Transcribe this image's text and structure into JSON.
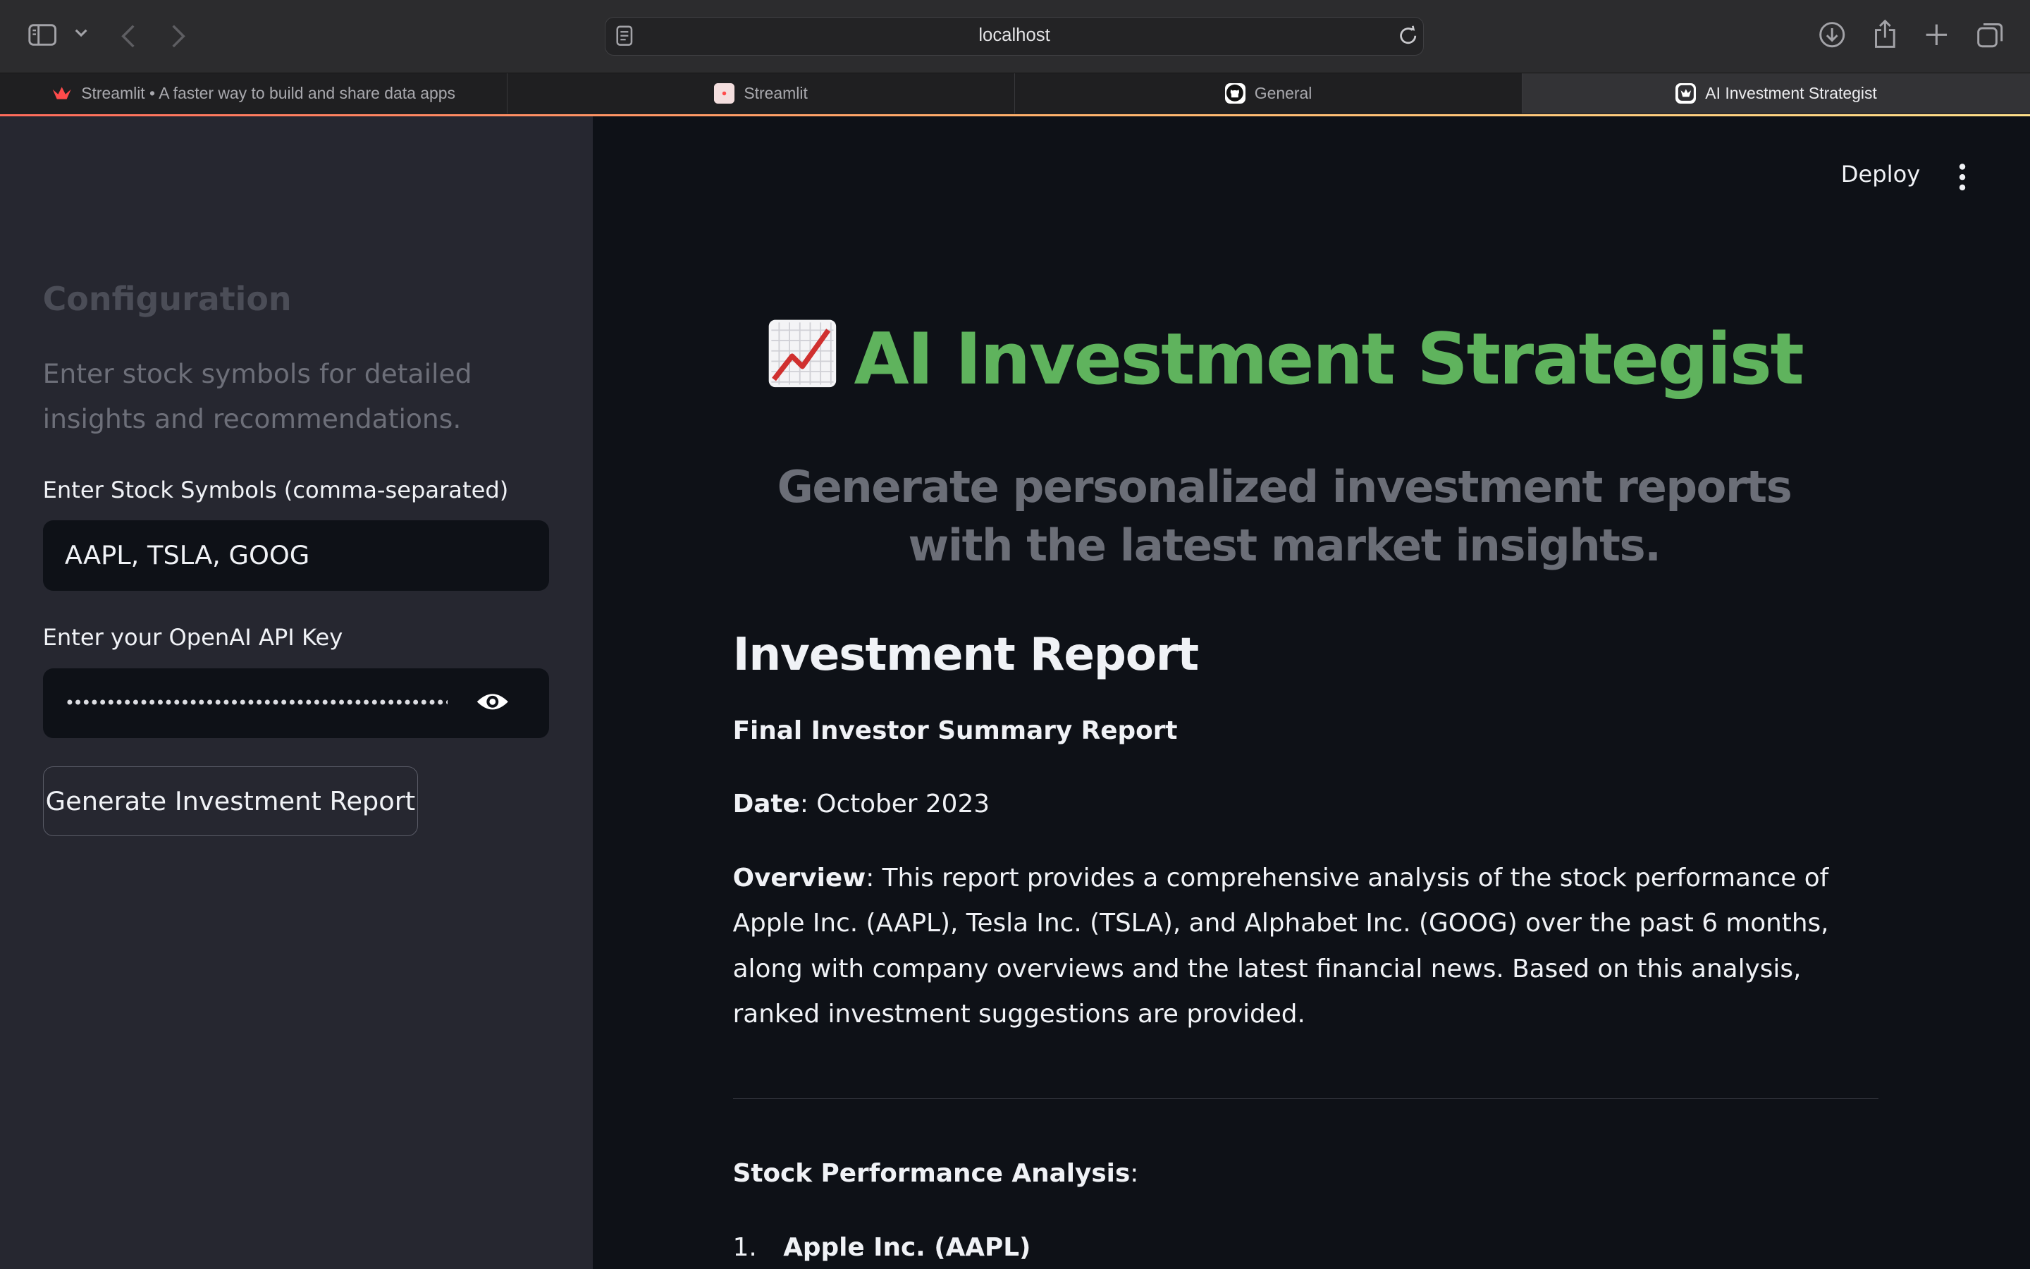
{
  "browser": {
    "url": "localhost",
    "tabs": [
      {
        "title": "Streamlit • A faster way to build and share data apps",
        "icon": "streamlit-crown-icon"
      },
      {
        "title": "Streamlit",
        "icon": "streamlit-favicon"
      },
      {
        "title": "General",
        "icon": "github-icon"
      },
      {
        "title": "AI Investment Strategist",
        "icon": "streamlit-favicon"
      }
    ],
    "active_tab": 3
  },
  "sidebar": {
    "title": "Configuration",
    "description": "Enter stock symbols for detailed insights and recommendations.",
    "symbols_label": "Enter Stock Symbols (comma-separated)",
    "symbols_value": "AAPL, TSLA, GOOG",
    "api_key_label": "Enter your OpenAI API Key",
    "api_key_value": "••••••••••••••••••••••••••••••••••••••••••••••••••",
    "generate_button": "Generate Investment Report"
  },
  "header": {
    "deploy_label": "Deploy"
  },
  "main": {
    "title_emoji": "chart-increasing-icon",
    "title": "AI Investment Strategist",
    "subtitle": "Generate personalized investment reports with the latest market insights.",
    "report_heading": "Investment Report",
    "report_title": "Final Investor Summary Report",
    "date_label": "Date",
    "date_value": ": October 2023",
    "overview_label": "Overview",
    "overview_text": ": This report provides a comprehensive analysis of the stock performance of Apple Inc. (AAPL), Tesla Inc. (TSLA), and Alphabet Inc. (GOOG) over the past 6 months, along with company overviews and the latest financial news. Based on this analysis, ranked investment suggestions are provided.",
    "section_heading": "Stock Performance Analysis",
    "section_colon": ":",
    "list": [
      {
        "number": "1.",
        "label": "Apple Inc. (AAPL)"
      }
    ]
  },
  "colors": {
    "title_green": "#5fb35d",
    "app_background": "#0e1117",
    "sidebar_background": "#262730"
  }
}
